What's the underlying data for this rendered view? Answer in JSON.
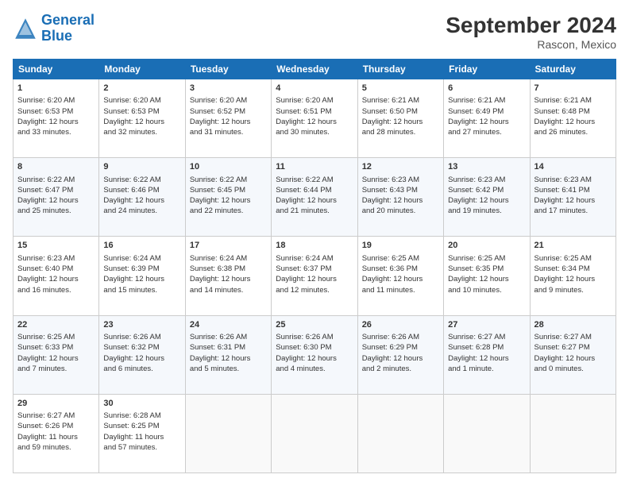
{
  "logo": {
    "line1": "General",
    "line2": "Blue"
  },
  "title": "September 2024",
  "subtitle": "Rascon, Mexico",
  "days_of_week": [
    "Sunday",
    "Monday",
    "Tuesday",
    "Wednesday",
    "Thursday",
    "Friday",
    "Saturday"
  ],
  "weeks": [
    [
      {
        "day": "1",
        "lines": [
          "Sunrise: 6:20 AM",
          "Sunset: 6:53 PM",
          "Daylight: 12 hours",
          "and 33 minutes."
        ]
      },
      {
        "day": "2",
        "lines": [
          "Sunrise: 6:20 AM",
          "Sunset: 6:53 PM",
          "Daylight: 12 hours",
          "and 32 minutes."
        ]
      },
      {
        "day": "3",
        "lines": [
          "Sunrise: 6:20 AM",
          "Sunset: 6:52 PM",
          "Daylight: 12 hours",
          "and 31 minutes."
        ]
      },
      {
        "day": "4",
        "lines": [
          "Sunrise: 6:20 AM",
          "Sunset: 6:51 PM",
          "Daylight: 12 hours",
          "and 30 minutes."
        ]
      },
      {
        "day": "5",
        "lines": [
          "Sunrise: 6:21 AM",
          "Sunset: 6:50 PM",
          "Daylight: 12 hours",
          "and 28 minutes."
        ]
      },
      {
        "day": "6",
        "lines": [
          "Sunrise: 6:21 AM",
          "Sunset: 6:49 PM",
          "Daylight: 12 hours",
          "and 27 minutes."
        ]
      },
      {
        "day": "7",
        "lines": [
          "Sunrise: 6:21 AM",
          "Sunset: 6:48 PM",
          "Daylight: 12 hours",
          "and 26 minutes."
        ]
      }
    ],
    [
      {
        "day": "8",
        "lines": [
          "Sunrise: 6:22 AM",
          "Sunset: 6:47 PM",
          "Daylight: 12 hours",
          "and 25 minutes."
        ]
      },
      {
        "day": "9",
        "lines": [
          "Sunrise: 6:22 AM",
          "Sunset: 6:46 PM",
          "Daylight: 12 hours",
          "and 24 minutes."
        ]
      },
      {
        "day": "10",
        "lines": [
          "Sunrise: 6:22 AM",
          "Sunset: 6:45 PM",
          "Daylight: 12 hours",
          "and 22 minutes."
        ]
      },
      {
        "day": "11",
        "lines": [
          "Sunrise: 6:22 AM",
          "Sunset: 6:44 PM",
          "Daylight: 12 hours",
          "and 21 minutes."
        ]
      },
      {
        "day": "12",
        "lines": [
          "Sunrise: 6:23 AM",
          "Sunset: 6:43 PM",
          "Daylight: 12 hours",
          "and 20 minutes."
        ]
      },
      {
        "day": "13",
        "lines": [
          "Sunrise: 6:23 AM",
          "Sunset: 6:42 PM",
          "Daylight: 12 hours",
          "and 19 minutes."
        ]
      },
      {
        "day": "14",
        "lines": [
          "Sunrise: 6:23 AM",
          "Sunset: 6:41 PM",
          "Daylight: 12 hours",
          "and 17 minutes."
        ]
      }
    ],
    [
      {
        "day": "15",
        "lines": [
          "Sunrise: 6:23 AM",
          "Sunset: 6:40 PM",
          "Daylight: 12 hours",
          "and 16 minutes."
        ]
      },
      {
        "day": "16",
        "lines": [
          "Sunrise: 6:24 AM",
          "Sunset: 6:39 PM",
          "Daylight: 12 hours",
          "and 15 minutes."
        ]
      },
      {
        "day": "17",
        "lines": [
          "Sunrise: 6:24 AM",
          "Sunset: 6:38 PM",
          "Daylight: 12 hours",
          "and 14 minutes."
        ]
      },
      {
        "day": "18",
        "lines": [
          "Sunrise: 6:24 AM",
          "Sunset: 6:37 PM",
          "Daylight: 12 hours",
          "and 12 minutes."
        ]
      },
      {
        "day": "19",
        "lines": [
          "Sunrise: 6:25 AM",
          "Sunset: 6:36 PM",
          "Daylight: 12 hours",
          "and 11 minutes."
        ]
      },
      {
        "day": "20",
        "lines": [
          "Sunrise: 6:25 AM",
          "Sunset: 6:35 PM",
          "Daylight: 12 hours",
          "and 10 minutes."
        ]
      },
      {
        "day": "21",
        "lines": [
          "Sunrise: 6:25 AM",
          "Sunset: 6:34 PM",
          "Daylight: 12 hours",
          "and 9 minutes."
        ]
      }
    ],
    [
      {
        "day": "22",
        "lines": [
          "Sunrise: 6:25 AM",
          "Sunset: 6:33 PM",
          "Daylight: 12 hours",
          "and 7 minutes."
        ]
      },
      {
        "day": "23",
        "lines": [
          "Sunrise: 6:26 AM",
          "Sunset: 6:32 PM",
          "Daylight: 12 hours",
          "and 6 minutes."
        ]
      },
      {
        "day": "24",
        "lines": [
          "Sunrise: 6:26 AM",
          "Sunset: 6:31 PM",
          "Daylight: 12 hours",
          "and 5 minutes."
        ]
      },
      {
        "day": "25",
        "lines": [
          "Sunrise: 6:26 AM",
          "Sunset: 6:30 PM",
          "Daylight: 12 hours",
          "and 4 minutes."
        ]
      },
      {
        "day": "26",
        "lines": [
          "Sunrise: 6:26 AM",
          "Sunset: 6:29 PM",
          "Daylight: 12 hours",
          "and 2 minutes."
        ]
      },
      {
        "day": "27",
        "lines": [
          "Sunrise: 6:27 AM",
          "Sunset: 6:28 PM",
          "Daylight: 12 hours",
          "and 1 minute."
        ]
      },
      {
        "day": "28",
        "lines": [
          "Sunrise: 6:27 AM",
          "Sunset: 6:27 PM",
          "Daylight: 12 hours",
          "and 0 minutes."
        ]
      }
    ],
    [
      {
        "day": "29",
        "lines": [
          "Sunrise: 6:27 AM",
          "Sunset: 6:26 PM",
          "Daylight: 11 hours",
          "and 59 minutes."
        ]
      },
      {
        "day": "30",
        "lines": [
          "Sunrise: 6:28 AM",
          "Sunset: 6:25 PM",
          "Daylight: 11 hours",
          "and 57 minutes."
        ]
      },
      null,
      null,
      null,
      null,
      null
    ]
  ]
}
